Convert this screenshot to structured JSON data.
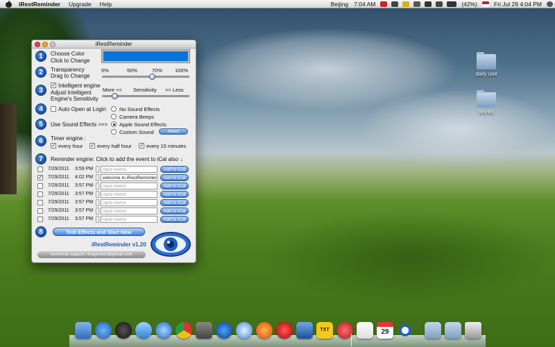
{
  "menubar": {
    "app_name": "iRestReminder",
    "menus": [
      "Upgrade",
      "Help"
    ],
    "clock_city": "Beijing",
    "clock_time": "7:04 AM",
    "battery": "(42%)",
    "datetime": "Fri Jul 29  4:04 PM"
  },
  "window": {
    "title": "iRestReminder",
    "step1": {
      "num": "1",
      "line1": "Choose Color",
      "line2": "Click to Change",
      "color": "#0a74d8"
    },
    "step2": {
      "num": "2",
      "line1": "Transparency",
      "line2": "Drag to Change",
      "ticks": [
        "5%",
        "50%",
        "70%",
        "100%"
      ],
      "value_percent": 60
    },
    "step3": {
      "num": "3",
      "checkbox": "Intelligent engine",
      "line2": "Adjust Intelligent",
      "line3": "Engine's Sensitivity",
      "more": "More <<",
      "sensitivity": "Sensitivity",
      "less": ">> Less",
      "value_fraction": 0.15
    },
    "step4": {
      "num": "4",
      "auto_open": "Auto Open at Login",
      "sound_options": [
        "No Sound Effects",
        "Camera Beeps",
        "Apple Sound Effects",
        "Custom Sound"
      ],
      "selected_sound": "Apple Sound Effects"
    },
    "step5": {
      "num": "5",
      "label": "Use Sound Effects  >>>",
      "select_button": "Select"
    },
    "step6": {
      "num": "6",
      "label": "Timer engine :",
      "options": [
        "every hour",
        "every half hour",
        "every 15 minutes"
      ]
    },
    "step7": {
      "num": "7",
      "label": "Reminder engine:  Click to add the event to iCal also ↓"
    },
    "reminders": [
      {
        "checked": false,
        "date": "7/29/2011",
        "time": "3:59 PM",
        "memo": "input memo",
        "filled": false,
        "button": "Add to iCal"
      },
      {
        "checked": true,
        "date": "7/29/2011",
        "time": "4:02 PM",
        "memo": "welcome to iRestReminder!",
        "filled": true,
        "button": "Add to iCal"
      },
      {
        "checked": false,
        "date": "7/29/2011",
        "time": "3:57 PM",
        "memo": "input memo",
        "filled": false,
        "button": "Add to iCal"
      },
      {
        "checked": false,
        "date": "7/29/2011",
        "time": "3:57 PM",
        "memo": "input memo",
        "filled": false,
        "button": "Add to iCal"
      },
      {
        "checked": false,
        "date": "7/29/2011",
        "time": "3:57 PM",
        "memo": "input memo",
        "filled": false,
        "button": "Add to iCal"
      },
      {
        "checked": false,
        "date": "7/29/2011",
        "time": "3:57 PM",
        "memo": "input memo",
        "filled": false,
        "button": "Add to iCal"
      },
      {
        "checked": false,
        "date": "7/29/2011",
        "time": "3:57 PM",
        "memo": "input memo",
        "filled": false,
        "button": "Add to iCal"
      }
    ],
    "step8": {
      "num": "8",
      "button": "Test Effects and Start Now"
    },
    "version": "iRestReminder v1.20",
    "support": "technical support: dragonbtv@gmail.com"
  },
  "desktop": {
    "folders": [
      "daily use",
      "works"
    ]
  },
  "dock": {
    "calendar_day": "29",
    "txt_label": "TXT",
    "icons": [
      "finder-icon",
      "app-store-icon",
      "dashboard-icon",
      "ichat-icon",
      "itunes-icon",
      "chrome-icon",
      "photo-booth-icon",
      "google-earth-icon",
      "safari-icon",
      "firefox-icon",
      "opera-icon",
      "xcode-icon",
      "textwrangler-icon",
      "zotero-icon",
      "preview-icon",
      "ical-icon",
      "irestreminder-icon",
      "applications-folder-icon",
      "documents-folder-icon",
      "trash-icon"
    ]
  }
}
